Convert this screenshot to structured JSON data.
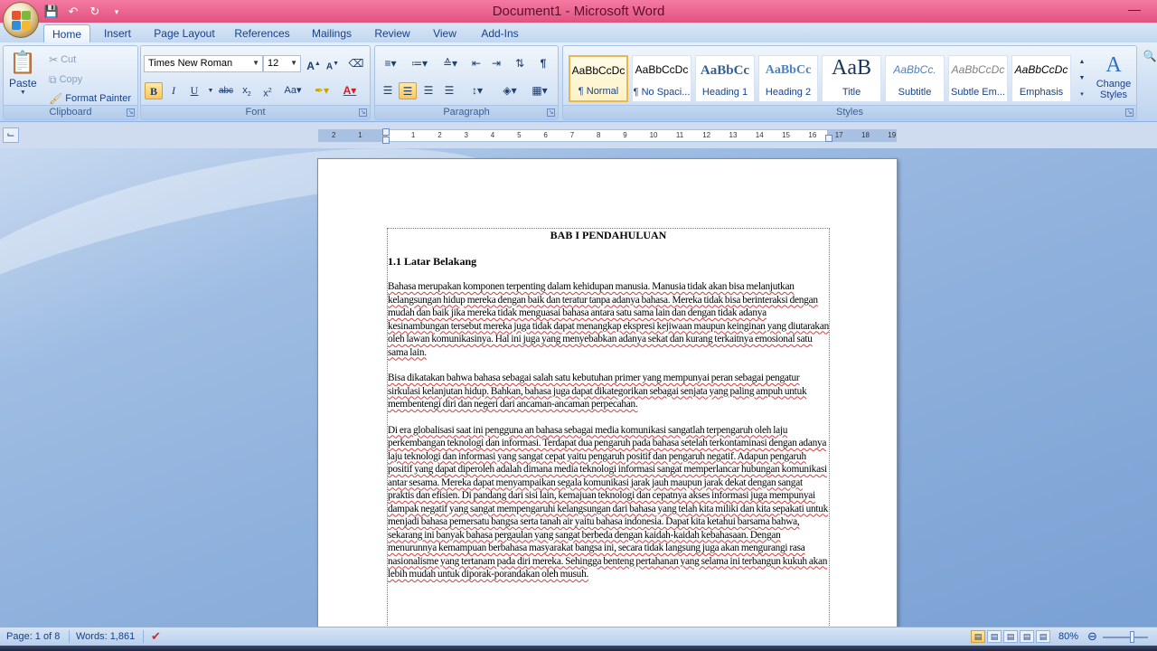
{
  "window": {
    "title": "Document1 - Microsoft Word"
  },
  "tabs": [
    "Home",
    "Insert",
    "Page Layout",
    "References",
    "Mailings",
    "Review",
    "View",
    "Add-Ins"
  ],
  "clipboard": {
    "paste": "Paste",
    "cut": "Cut",
    "copy": "Copy",
    "format_painter": "Format Painter",
    "label": "Clipboard"
  },
  "font": {
    "name": "Times New Roman",
    "size": "12",
    "label": "Font"
  },
  "paragraph": {
    "label": "Paragraph"
  },
  "styles": {
    "label": "Styles",
    "items": [
      {
        "sample": "AaBbCcDc",
        "name": "¶ Normal"
      },
      {
        "sample": "AaBbCcDc",
        "name": "¶ No Spaci..."
      },
      {
        "sample": "AaBbCc",
        "name": "Heading 1"
      },
      {
        "sample": "AaBbCc",
        "name": "Heading 2"
      },
      {
        "sample": "AaB",
        "name": "Title"
      },
      {
        "sample": "AaBbCc.",
        "name": "Subtitle"
      },
      {
        "sample": "AaBbCcDc",
        "name": "Subtle Em..."
      },
      {
        "sample": "AaBbCcDc",
        "name": "Emphasis"
      }
    ],
    "change_styles": "Change Styles"
  },
  "ruler": {
    "ticks": [
      "2",
      "1",
      "1",
      "1",
      "2",
      "3",
      "4",
      "5",
      "6",
      "7",
      "8",
      "9",
      "10",
      "11",
      "12",
      "13",
      "14",
      "15",
      "16",
      "17",
      "18",
      "19"
    ]
  },
  "document": {
    "title": "BAB I PENDAHULUAN",
    "heading": "1.1  Latar Belakang",
    "paragraphs": [
      "Bahasa merupakan komponen terpenting dalam kehidupan manusia. Manusia tidak akan bisa melanjutkan kelangsungan hidup mereka dengan baik dan teratur tanpa adanya bahasa. Mereka tidak bisa berinteraksi dengan mudah dan baik jika mereka tidak menguasai bahasa antara satu sama lain dan dengan tidak adanya kesinambungan tersebut mereka juga tidak dapat menangkap ekspresi kejiwaan maupun keinginan yang diutarakan oleh lawan komunikasinya. Hal ini juga yang menyebabkan adanya sekat dan kurang terkaitnya emosional satu sama lain.",
      "Bisa dikatakan bahwa bahasa sebagai salah satu kebutuhan primer yang mempunyai peran sebagai pengatur sirkulasi kelanjutan hidup. Bahkan, bahasa juga dapat dikategorikan sebagai senjata yang paling ampuh untuk membentengi diri dan negeri dari ancaman-ancaman perpecahan.",
      "Di era globalisasi saat ini pengguna an bahasa sebagai media komunikasi sangatlah terpengaruh oleh laju perkembangan teknologi dan informasi.  Terdapat dua pengaruh pada bahasa setelah terkontaminasi dengan adanya laju teknologi dan informasi yang sangat cepat yaitu pengaruh positif dan pengaruh negatif. Adapun pengaruh positif yang dapat diperoleh adalah dimana media teknologi informasi sangat memperlancar hubungan komunikasi antar sesama. Mereka dapat menyampaikan segala komunikasi jarak jauh maupun jarak dekat dengan sangat praktis dan efisien.  Di pandang dari sisi lain, kemajuan teknologi dan cepatnya akses informasi juga mempunyai dampak negatif yang sangat mempengaruhi kelangsungan dari bahasa yang telah kita miliki dan kita sepakati untuk menjadi bahasa pemersatu bangsa serta tanah air yaitu bahasa indonesia. Dapat kita ketahui barsama bahwa, sekarang ini banyak bahasa pergaulan yang sangat berbeda dengan kaidah-kaidah kebahasaan. Dengan menurunnya kemampuan berbahasa masyarakat bangsa ini, secara tidak langsung juga akan mengurangi rasa nasionalisme yang tertanam pada diri mereka. Sehingga benteng pertahanan yang selama ini terbangun kukuh akan lebih mudah untuk diporak-porandakan oleh musuh."
    ]
  },
  "status": {
    "page": "Page: 1 of 8",
    "words": "Words: 1,861",
    "zoom": "80%"
  },
  "colors": {
    "titlebar": "#e2527f",
    "ribbon": "#c5d9f1",
    "accent": "#15428b"
  }
}
